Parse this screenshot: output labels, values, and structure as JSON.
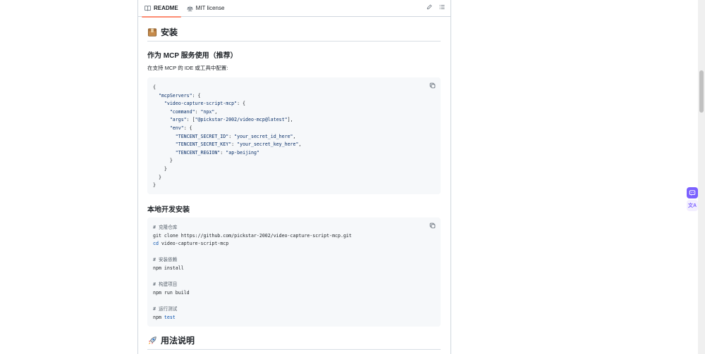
{
  "tabs": {
    "readme": "README",
    "license": "MIT license"
  },
  "install": {
    "heading": "安装",
    "mcp_title": "作为 MCP 服务使用（推荐）",
    "mcp_desc": "在支持 MCP 的 IDE 或工具中配置:"
  },
  "local": {
    "heading": "本地开发安装"
  },
  "usage": {
    "heading": "用法说明"
  },
  "side_widget": {
    "translate_label": "文A"
  },
  "colors": {
    "tab_underline": "#fd8c73",
    "code_bg": "#f6f8fa",
    "string": "#0a3069",
    "keyword": "#0550ae",
    "widget": "#7b61ff"
  },
  "icons": [
    "book-icon",
    "scale-icon",
    "pencil-icon",
    "list-icon",
    "copy-icon",
    "package-icon",
    "rocket-icon"
  ]
}
